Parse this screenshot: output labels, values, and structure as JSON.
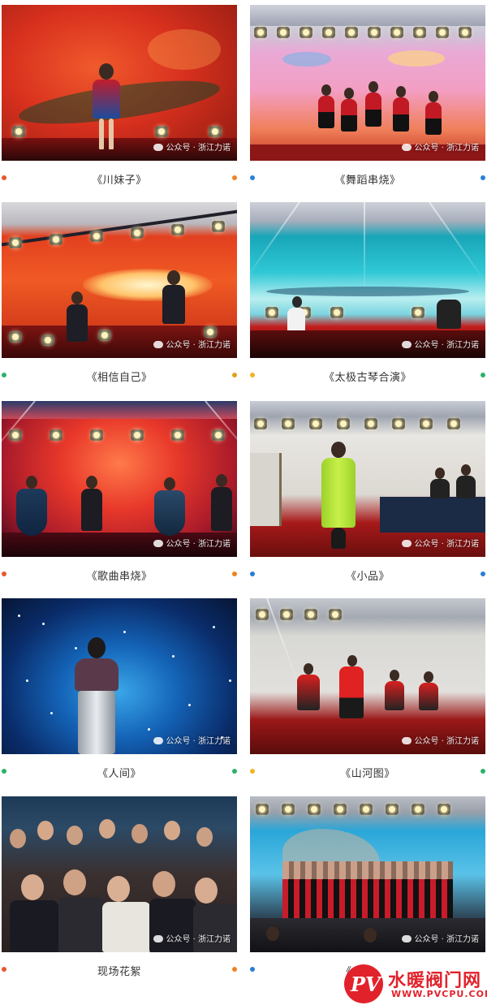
{
  "watermark": "公众号 · 浙江力诺",
  "items": [
    {
      "caption": "《川妹子》",
      "dot_left": "#e8572d",
      "dot_right": "#f0831e"
    },
    {
      "caption": "《舞蹈串烧》",
      "dot_left": "#2a7fd4",
      "dot_right": "#2a7fd4"
    },
    {
      "caption": "《相信自己》",
      "dot_left": "#2bb36b",
      "dot_right": "#e4a21a"
    },
    {
      "caption": "《太极古琴合演》",
      "dot_left": "#f0b323",
      "dot_right": "#2bb36b"
    },
    {
      "caption": "《歌曲串烧》",
      "dot_left": "#e8572d",
      "dot_right": "#f0831e"
    },
    {
      "caption": "《小品》",
      "dot_left": "#2a7fd4",
      "dot_right": "#2a7fd4"
    },
    {
      "caption": "《人间》",
      "dot_left": "#2bb36b",
      "dot_right": "#2bb36b"
    },
    {
      "caption": "《山河图》",
      "dot_left": "#f0b323",
      "dot_right": "#2bb36b"
    },
    {
      "caption": "现场花絮",
      "dot_left": "#e8572d",
      "dot_right": "#f0831e"
    },
    {
      "caption": "《",
      "dot_left": "#2a7fd4",
      "dot_right": ""
    }
  ],
  "logo": {
    "mark": "PV",
    "title": "水暖阀门网",
    "url": "WWW.PVCPU.COM"
  }
}
